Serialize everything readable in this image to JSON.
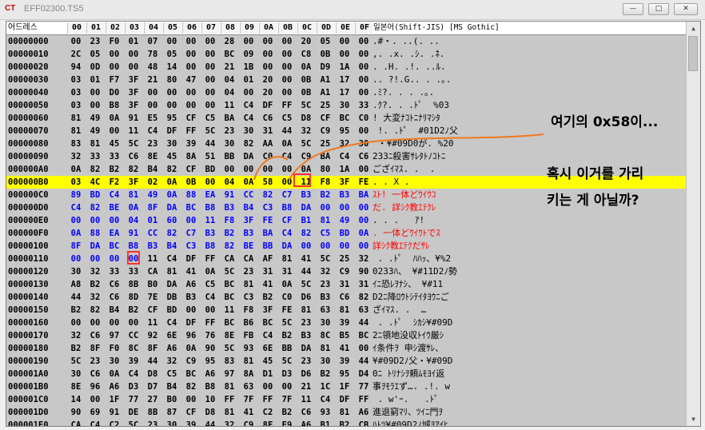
{
  "window": {
    "app_logo": "CT",
    "title": "EFF02300.TS5",
    "buttons": {
      "minimize": "—",
      "maximize": "□",
      "close": "✕"
    }
  },
  "header": {
    "address_label": "어드레스",
    "columns": [
      "00",
      "01",
      "02",
      "03",
      "04",
      "05",
      "06",
      "07",
      "08",
      "09",
      "0A",
      "0B",
      "0C",
      "0D",
      "0E",
      "0F"
    ],
    "text_label": "일본어(Shift-JIS) [MS Gothic]"
  },
  "rows": [
    {
      "addr": "00000000",
      "bytes": [
        "00",
        "23",
        "F0",
        "01",
        "07",
        "00",
        "00",
        "00",
        "28",
        "00",
        "00",
        "00",
        "20",
        "05",
        "00",
        "00"
      ],
      "text": ".#・. ..(. .."
    },
    {
      "addr": "00000010",
      "bytes": [
        "2C",
        "05",
        "00",
        "00",
        "78",
        "05",
        "00",
        "00",
        "BC",
        "09",
        "00",
        "00",
        "C8",
        "0B",
        "00",
        "00"
      ],
      "text": ",. .x. .ｼ. .ﾈ."
    },
    {
      "addr": "00000020",
      "bytes": [
        "94",
        "0D",
        "00",
        "00",
        "48",
        "14",
        "00",
        "00",
        "21",
        "1B",
        "00",
        "00",
        "0A",
        "D9",
        "1A",
        "00"
      ],
      "text": ". .H. .!. ..ﾙ."
    },
    {
      "addr": "00000030",
      "bytes": [
        "03",
        "01",
        "F7",
        "3F",
        "21",
        "80",
        "47",
        "00",
        "04",
        "01",
        "20",
        "00",
        "0B",
        "A1",
        "17",
        "00"
      ],
      "text": ".. ?!.G.. . .｡."
    },
    {
      "addr": "00000040",
      "bytes": [
        "03",
        "00",
        "D0",
        "3F",
        "00",
        "00",
        "00",
        "00",
        "04",
        "00",
        "20",
        "00",
        "0B",
        "A1",
        "17",
        "00"
      ],
      "text": ".ﾐ?. . . .｡."
    },
    {
      "addr": "00000050",
      "bytes": [
        "03",
        "00",
        "B8",
        "3F",
        "00",
        "00",
        "00",
        "00",
        "11",
        "C4",
        "DF",
        "FF",
        "5C",
        "25",
        "30",
        "33"
      ],
      "text": ".ｸ?. . .ﾄﾟ  %03"
    },
    {
      "addr": "00000060",
      "bytes": [
        "81",
        "49",
        "0A",
        "91",
        "E5",
        "95",
        "CF",
        "C5",
        "BA",
        "C4",
        "C6",
        "C5",
        "D8",
        "CF",
        "BC",
        "C0"
      ],
      "text": "! 大変ﾅｺﾄﾆﾅﾘﾏｼﾀ"
    },
    {
      "addr": "00000070",
      "bytes": [
        "81",
        "49",
        "00",
        "11",
        "C4",
        "DF",
        "FF",
        "5C",
        "23",
        "30",
        "31",
        "44",
        "32",
        "C9",
        "95",
        "00"
      ],
      "text": " !. .ﾄﾟ  #01D2ﾉ父"
    },
    {
      "addr": "00000080",
      "bytes": [
        "83",
        "81",
        "45",
        "5C",
        "23",
        "30",
        "39",
        "44",
        "30",
        "82",
        "AA",
        "0A",
        "5C",
        "25",
        "32",
        "30"
      ],
      "text": " ・¥#09D0が. %20"
    },
    {
      "addr": "00000090",
      "bytes": [
        "32",
        "33",
        "33",
        "C6",
        "8E",
        "45",
        "8A",
        "51",
        "BB",
        "DA",
        "C0",
        "C4",
        "C9",
        "BA",
        "C4",
        "C6"
      ],
      "text": "233ﾆ殺害ｻﾚﾀﾄﾉｺﾄﾆ"
    },
    {
      "addr": "000000A0",
      "bytes": [
        "0A",
        "82",
        "B2",
        "82",
        "B4",
        "82",
        "CF",
        "BD",
        "00",
        "00",
        "00",
        "00",
        "0A",
        "80",
        "1A",
        "00"
      ],
      "text": "ござｲﾏｽ. .  ."
    },
    {
      "addr": "000000B0",
      "bytes": [
        "03",
        "4C",
        "F2",
        "3F",
        "02",
        "0A",
        "0B",
        "00",
        "04",
        "0A",
        "58",
        "00",
        "11",
        "F8",
        "3F",
        "FE"
      ],
      "text": ". . X ."
    },
    {
      "addr": "000000C0",
      "bytes": [
        "89",
        "BD",
        "C4",
        "81",
        "49",
        "0A",
        "88",
        "EA",
        "91",
        "CC",
        "82",
        "C7",
        "B3",
        "B2",
        "B3",
        "BA"
      ],
      "text": "ｽﾄ! 一体どｳｲｳｺ"
    },
    {
      "addr": "000000D0",
      "bytes": [
        "C4",
        "82",
        "BE",
        "0A",
        "8F",
        "DA",
        "BC",
        "B8",
        "B3",
        "B4",
        "C3",
        "B8",
        "DA",
        "00",
        "00",
        "00"
      ],
      "text": "だ. 詳ｼｸ教ｴﾃｸﾚ"
    },
    {
      "addr": "000000E0",
      "bytes": [
        "00",
        "00",
        "00",
        "04",
        "01",
        "60",
        "00",
        "11",
        "F8",
        "3F",
        "FE",
        "CF",
        "B1",
        "81",
        "49",
        "00"
      ],
      "text": ". . .   ｱ!"
    },
    {
      "addr": "000000F0",
      "bytes": [
        "0A",
        "88",
        "EA",
        "91",
        "CC",
        "82",
        "C7",
        "B3",
        "B2",
        "B3",
        "BA",
        "C4",
        "82",
        "C5",
        "BD",
        "0A"
      ],
      "text": ". 一体どｳｲｳﾄでｽ"
    },
    {
      "addr": "00000100",
      "bytes": [
        "8F",
        "DA",
        "BC",
        "B8",
        "B3",
        "B4",
        "C3",
        "B8",
        "82",
        "BE",
        "BB",
        "DA",
        "00",
        "00",
        "00",
        "00"
      ],
      "text": "詳ｼｸ教ｴﾃｸだｻﾚ"
    },
    {
      "addr": "00000110",
      "bytes": [
        "00",
        "00",
        "00",
        "00",
        "11",
        "C4",
        "DF",
        "FF",
        "CA",
        "CA",
        "AF",
        "81",
        "41",
        "5C",
        "25",
        "32"
      ],
      "text": " . .ﾄﾟ  ﾊﾊｯ、¥%2"
    },
    {
      "addr": "00000120",
      "bytes": [
        "30",
        "32",
        "33",
        "33",
        "CA",
        "81",
        "41",
        "0A",
        "5C",
        "23",
        "31",
        "31",
        "44",
        "32",
        "C9",
        "90"
      ],
      "text": "0233ﾊ、 ¥#11D2ﾉ勢"
    },
    {
      "addr": "00000130",
      "bytes": [
        "A8",
        "B2",
        "C6",
        "8B",
        "B0",
        "DA",
        "A6",
        "C5",
        "BC",
        "81",
        "41",
        "0A",
        "5C",
        "23",
        "31",
        "31"
      ],
      "text": "ｲﾆ恐ﾚｦﾅｼ、 ¥#11"
    },
    {
      "addr": "00000140",
      "bytes": [
        "44",
        "32",
        "C6",
        "8D",
        "7E",
        "DB",
        "B3",
        "C4",
        "BC",
        "C3",
        "B2",
        "C0",
        "D6",
        "B3",
        "C6",
        "82"
      ],
      "text": "D2ﾆ降ﾛｳﾄｼﾃｲﾀﾖｳﾆご"
    },
    {
      "addr": "00000150",
      "bytes": [
        "B2",
        "82",
        "B4",
        "B2",
        "CF",
        "BD",
        "00",
        "00",
        "11",
        "F8",
        "3F",
        "FE",
        "81",
        "63",
        "81",
        "63"
      ],
      "text": "ざｲﾏｽ. .  …"
    },
    {
      "addr": "00000160",
      "bytes": [
        "00",
        "00",
        "00",
        "00",
        "11",
        "C4",
        "DF",
        "FF",
        "BC",
        "B6",
        "BC",
        "5C",
        "23",
        "30",
        "39",
        "44"
      ],
      "text": " . .ﾄﾟ  ｼｶｼ¥#09D"
    },
    {
      "addr": "00000170",
      "bytes": [
        "32",
        "C6",
        "97",
        "CC",
        "92",
        "6E",
        "96",
        "76",
        "8E",
        "FB",
        "C4",
        "B2",
        "B3",
        "8C",
        "B5",
        "BC"
      ],
      "text": "2ﾆ領地没収ﾄｲｳ厳ｼ"
    },
    {
      "addr": "00000180",
      "bytes": [
        "B2",
        "8F",
        "F0",
        "8C",
        "8F",
        "A6",
        "0A",
        "90",
        "5C",
        "93",
        "6E",
        "BB",
        "DA",
        "81",
        "41",
        "00"
      ],
      "text": "ｲ条件ｦ 申ｼ渡ｻﾚ、"
    },
    {
      "addr": "00000190",
      "bytes": [
        "5C",
        "23",
        "30",
        "39",
        "44",
        "32",
        "C9",
        "95",
        "83",
        "81",
        "45",
        "5C",
        "23",
        "30",
        "39",
        "44"
      ],
      "text": "¥#09D2ﾉ父・¥#09D"
    },
    {
      "addr": "000001A0",
      "bytes": [
        "30",
        "C6",
        "0A",
        "C4",
        "D8",
        "C5",
        "BC",
        "A6",
        "97",
        "8A",
        "D1",
        "D3",
        "D6",
        "B2",
        "95",
        "D4"
      ],
      "text": "0ﾆ ﾄﾘﾅｼｦ頼ﾑﾓﾖｲ返"
    },
    {
      "addr": "000001B0",
      "bytes": [
        "8E",
        "96",
        "A6",
        "D3",
        "D7",
        "B4",
        "82",
        "B8",
        "81",
        "63",
        "00",
        "00",
        "21",
        "1C",
        "1F",
        "77"
      ],
      "text": "事ｦﾓﾗｴず…. .!. w"
    },
    {
      "addr": "000001C0",
      "bytes": [
        "14",
        "00",
        "1F",
        "77",
        "27",
        "B0",
        "00",
        "10",
        "FF",
        "7F",
        "FF",
        "7F",
        "11",
        "C4",
        "DF",
        "FF"
      ],
      "text": " . w'ｰ.   .ﾄﾟ"
    },
    {
      "addr": "000001D0",
      "bytes": [
        "90",
        "69",
        "91",
        "DE",
        "8B",
        "87",
        "CF",
        "D8",
        "81",
        "41",
        "C2",
        "B2",
        "C6",
        "93",
        "81",
        "A6"
      ],
      "text": "進退窮ﾏﾘ、ﾂｲﾆ門ｦ"
    },
    {
      "addr": "000001E0",
      "bytes": [
        "CA",
        "C4",
        "C2",
        "5C",
        "23",
        "30",
        "39",
        "44",
        "32",
        "C9",
        "8F",
        "E9",
        "A6",
        "B1",
        "B2",
        "CB"
      ],
      "text": "ﾊﾄﾂ¥#09D2ﾉ城ｦｱｲﾋ"
    }
  ],
  "annotations": {
    "line1": "여기의 0x58이...",
    "line2": "혹시 이거를 가리",
    "line3": "키는 게 아닐까?"
  },
  "colors": {
    "highlight": "#ffff00",
    "ascii_block": "#7b7bff",
    "red_mark": "#ff3030",
    "orange_arrow": "#f07820"
  }
}
